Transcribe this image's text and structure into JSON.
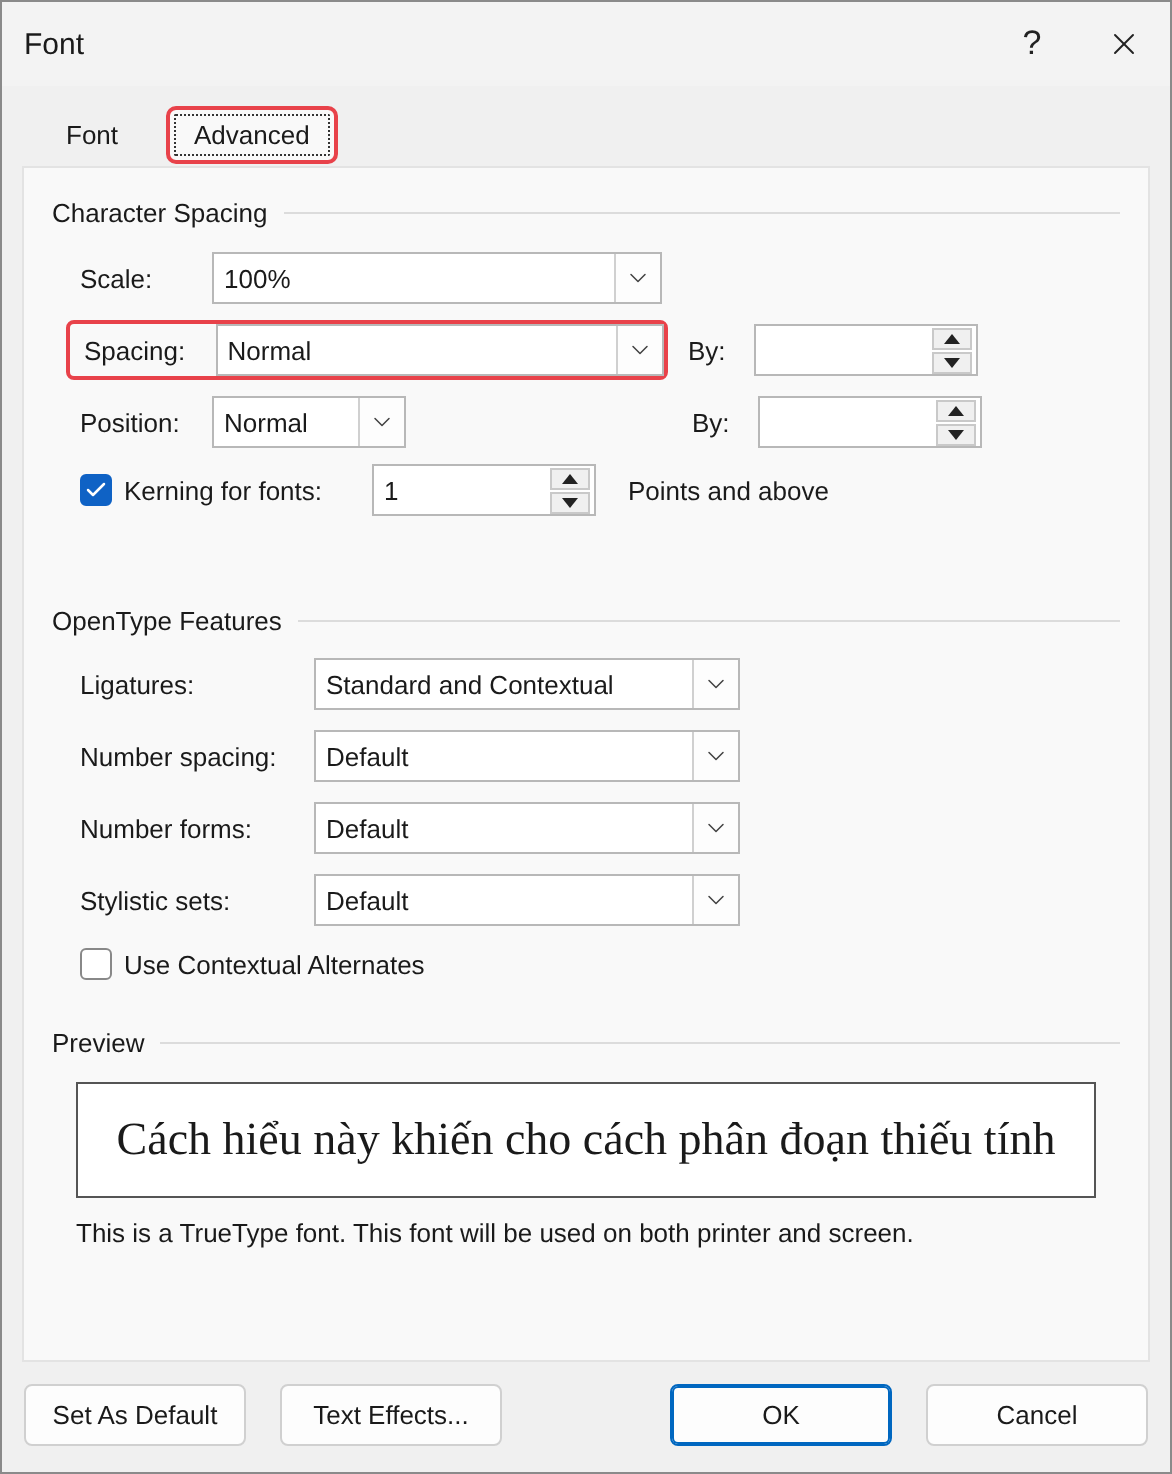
{
  "window": {
    "title": "Font",
    "help": "?"
  },
  "tabs": [
    {
      "label": "Font",
      "selected": false,
      "highlighted": false
    },
    {
      "label": "Advanced",
      "selected": true,
      "highlighted": true
    }
  ],
  "character_spacing": {
    "title": "Character Spacing",
    "scale": {
      "label": "Scale:",
      "value": "100%"
    },
    "spacing": {
      "label": "Spacing:",
      "value": "Normal",
      "highlighted": true,
      "by": {
        "label": "By:"
      }
    },
    "position": {
      "label": "Position:",
      "value": "Normal",
      "by": {
        "label": "By:"
      }
    },
    "kerning": {
      "label": "Kerning for fonts:",
      "checked": true,
      "value": "1",
      "suffix": "Points and above"
    }
  },
  "opentype_features": {
    "title": "OpenType Features",
    "dropdowns": [
      {
        "label": "Ligatures:",
        "value": "Standard and Contextual"
      },
      {
        "label": "Number spacing:",
        "value": "Default"
      },
      {
        "label": "Number forms:",
        "value": "Default"
      },
      {
        "label": "Stylistic sets:",
        "value": "Default"
      }
    ],
    "contextual_alternates": {
      "label": "Use Contextual Alternates",
      "checked": false
    }
  },
  "preview": {
    "title": "Preview",
    "sample": "Cách hiểu này khiến cho cách phân đoạn thiếu tính",
    "note": "This is a TrueType font. This font will be used on both printer and screen."
  },
  "buttons": [
    {
      "label": "Set As Default",
      "kind": "secondary"
    },
    {
      "label": "Text Effects...",
      "kind": "secondary"
    },
    {
      "label": "OK",
      "kind": "primary"
    },
    {
      "label": "Cancel",
      "kind": "secondary"
    }
  ]
}
